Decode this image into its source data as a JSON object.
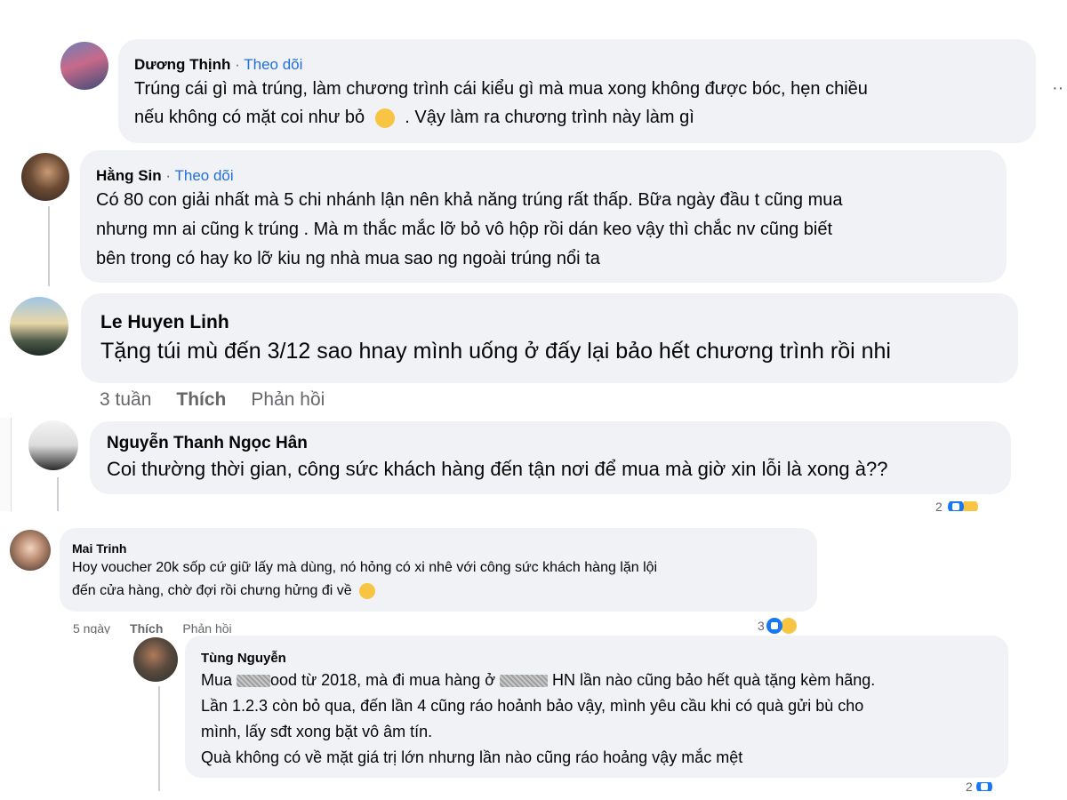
{
  "comments": [
    {
      "author": "Dương Thịnh",
      "follow": "Theo dõi",
      "lines": [
        "Trúng cái gì mà trúng, làm chương trình cái kiểu gì mà mua xong không được bóc, hẹn chiều",
        "nếu không có mặt coi như bỏ",
        ". Vậy làm ra chương trình này làm gì"
      ],
      "more": "··"
    },
    {
      "author": "Hằng Sin",
      "follow": "Theo dõi",
      "lines": [
        "Có 80 con giải nhất mà 5 chi nhánh lận nên khả năng trúng rất thấp. Bữa ngày đầu t cũng mua",
        "nhưng mn ai cũng k trúng . Mà m thắc mắc lỡ bỏ vô hộp rồi dán keo vậy thì chắc nv cũng biết",
        "bên trong có hay ko lỡ kiu ng nhà mua sao ng ngoài trúng nổi ta"
      ]
    },
    {
      "author": "Le Huyen Linh",
      "lines": [
        "Tặng túi mù đến 3/12 sao hnay mình uống ở đấy lại bảo hết chương trình rồi nhi"
      ],
      "time": "3 tuần",
      "like": "Thích",
      "reply": "Phản hồi"
    },
    {
      "author": "Nguyễn Thanh Ngọc Hân",
      "lines": [
        "Coi thường thời gian, công sức khách hàng đến tận nơi để mua mà giờ xin lỗi là xong à??"
      ],
      "react_count": "2"
    },
    {
      "author": "Mai Trinh",
      "lines": [
        "Hoy voucher 20k sốp cứ giữ lấy mà dùng, nó hỏng có xi nhê với công sức khách hàng lặn lội",
        "đến cửa hàng, chờ đợi rồi chưng hửng đi về"
      ],
      "time": "5 ngày",
      "like": "Thích",
      "reply": "Phản hồi",
      "react_count": "3"
    },
    {
      "author": "Tùng Nguyễn",
      "lines": [
        [
          "Mua ",
          "ood từ 2018, mà đi mua hàng ở ",
          " HN lần nào cũng bảo hết quà tặng kèm hãng."
        ],
        "Lần 1.2.3 còn bỏ qua, đến lần 4 cũng ráo hoảnh bảo vậy, mình yêu cầu khi có quà gửi bù cho",
        "mình, lấy sđt xong bặt vô âm tín.",
        "Quà không có về mặt giá trị lớn nhưng lần nào cũng ráo hoảng vậy mắc mệt"
      ],
      "react_count": "2"
    }
  ],
  "colors": {
    "bubble": "#f0f2f5",
    "link": "#216fdb",
    "muted": "#65676b",
    "like": "#1877f2"
  },
  "icons": [
    "avatar",
    "laugh-emoji-icon",
    "worried-emoji-icon",
    "like-reaction-icon",
    "haha-reaction-icon",
    "more-options-icon"
  ]
}
